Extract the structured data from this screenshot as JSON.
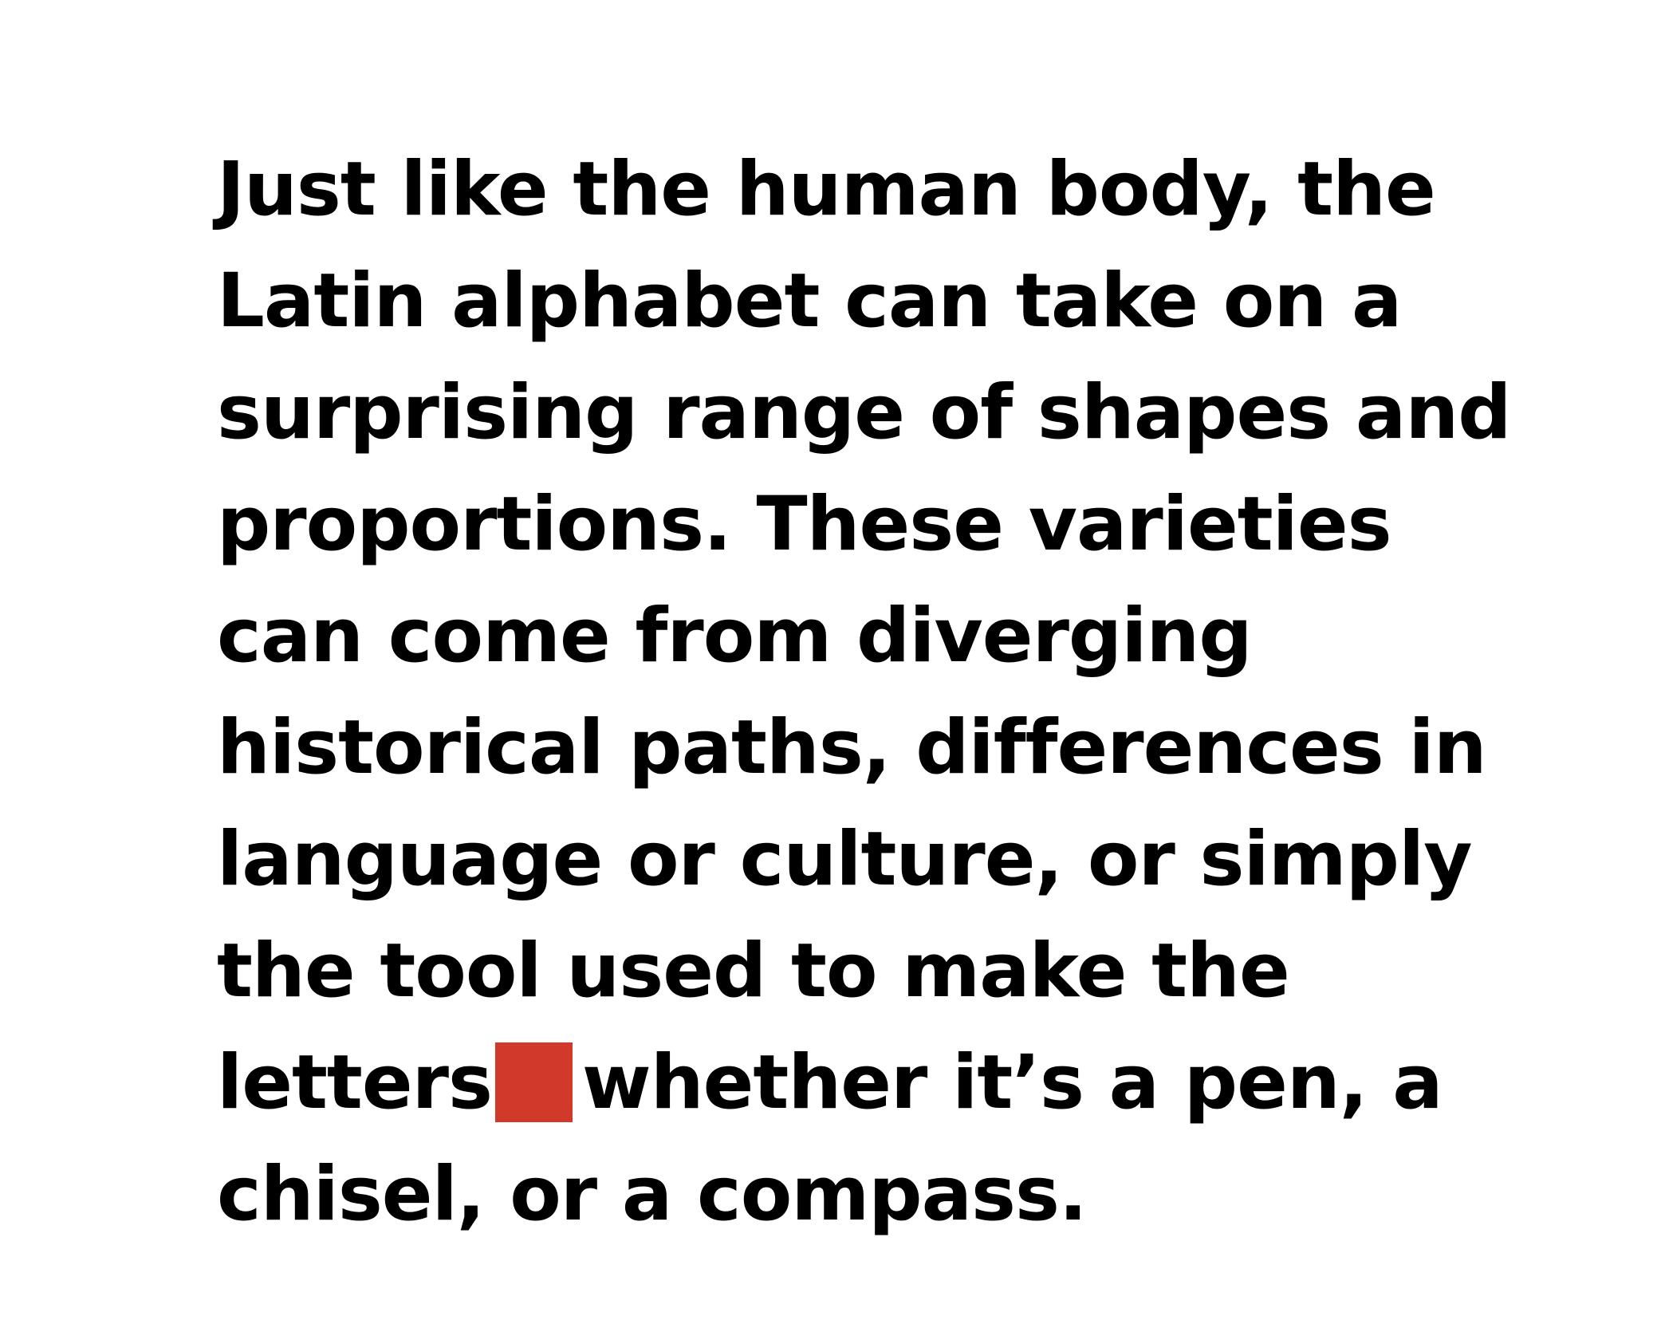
{
  "paragraph": {
    "lines": [
      "Just like the human body, the",
      "Latin alphabet can take on a",
      "surprising range of shapes and",
      "proportions. These varieties",
      "can come from diverging",
      "historical paths, differences in",
      "language or culture, or simply",
      "the tool used to make the",
      "whether it’s a pen, a",
      "chisel, or a compass."
    ],
    "line9_prefix": "letters"
  },
  "colors": {
    "text": "#000000",
    "background": "#ffffff",
    "accent_square": "#d13a2a"
  }
}
